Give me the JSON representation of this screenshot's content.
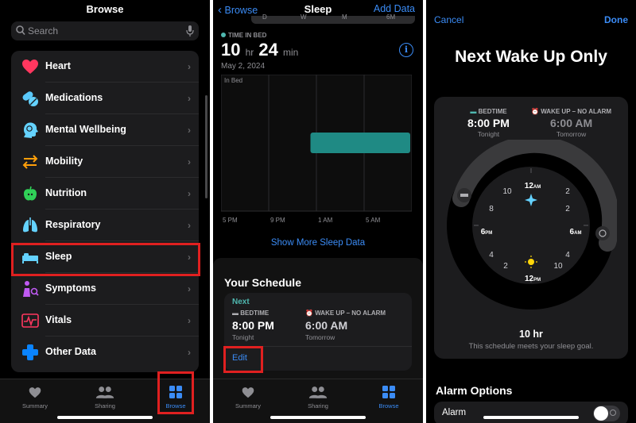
{
  "browse": {
    "title": "Browse",
    "search_placeholder": "Search",
    "categories": [
      {
        "label": "Heart"
      },
      {
        "label": "Medications"
      },
      {
        "label": "Mental Wellbeing"
      },
      {
        "label": "Mobility"
      },
      {
        "label": "Nutrition"
      },
      {
        "label": "Respiratory"
      },
      {
        "label": "Sleep"
      },
      {
        "label": "Symptoms"
      },
      {
        "label": "Vitals"
      },
      {
        "label": "Other Data"
      }
    ],
    "tabs": {
      "summary": "Summary",
      "sharing": "Sharing",
      "browse": "Browse"
    }
  },
  "sleep": {
    "back_label": "Browse",
    "title": "Sleep",
    "add_label": "Add Data",
    "segments": [
      "D",
      "W",
      "M",
      "6M"
    ],
    "time_in_bed_label": "TIME IN BED",
    "duration_hr": "10",
    "unit_hr": "hr",
    "duration_min": "24",
    "unit_min": "min",
    "date": "May 2, 2024",
    "info_glyph": "i",
    "more_link": "Show More Sleep Data",
    "schedule_title": "Your Schedule",
    "next_label": "Next",
    "bedtime_label": "BEDTIME",
    "bedtime_time": "8:00 PM",
    "bedtime_sub": "Tonight",
    "wake_label": "WAKE UP – NO ALARM",
    "wake_time": "6:00 AM",
    "wake_sub": "Tomorrow",
    "edit_label": "Edit",
    "tabs": {
      "summary": "Summary",
      "sharing": "Sharing",
      "browse": "Browse"
    }
  },
  "chart_data": {
    "type": "bar",
    "title": "",
    "series_label": "In Bed",
    "x_ticks": [
      "5 PM",
      "9 PM",
      "1 AM",
      "5 AM"
    ],
    "x_range_hours": [
      17,
      33
    ],
    "segments": [
      {
        "start": 24.5,
        "end": 34.0
      },
      {
        "start": 34.3,
        "end": 34.9
      }
    ],
    "color": "#1f8a84"
  },
  "schedule": {
    "cancel_label": "Cancel",
    "done_label": "Done",
    "title": "Next Wake Up Only",
    "bedtime_label": "BEDTIME",
    "bedtime_time": "8:00 PM",
    "bedtime_sub": "Tonight",
    "wake_label": "WAKE UP – NO ALARM",
    "wake_time": "6:00 AM",
    "wake_sub": "Tomorrow",
    "clock_labels": {
      "top_num": "12",
      "top_suf": "AM",
      "bottom_num": "12",
      "bottom_suf": "PM",
      "left_num": "6",
      "left_suf": "PM",
      "right_num": "6",
      "right_suf": "AM",
      "n10": "10",
      "n2": "2",
      "n8": "8",
      "n4": "4"
    },
    "duration": "10 hr",
    "goal_text": "This schedule meets your sleep goal.",
    "alarm_header": "Alarm Options",
    "alarm_label": "Alarm"
  },
  "colors": {
    "accent": "#3b8cf6",
    "sleep_teal": "#4fb8b0",
    "highlight": "#e02020"
  }
}
